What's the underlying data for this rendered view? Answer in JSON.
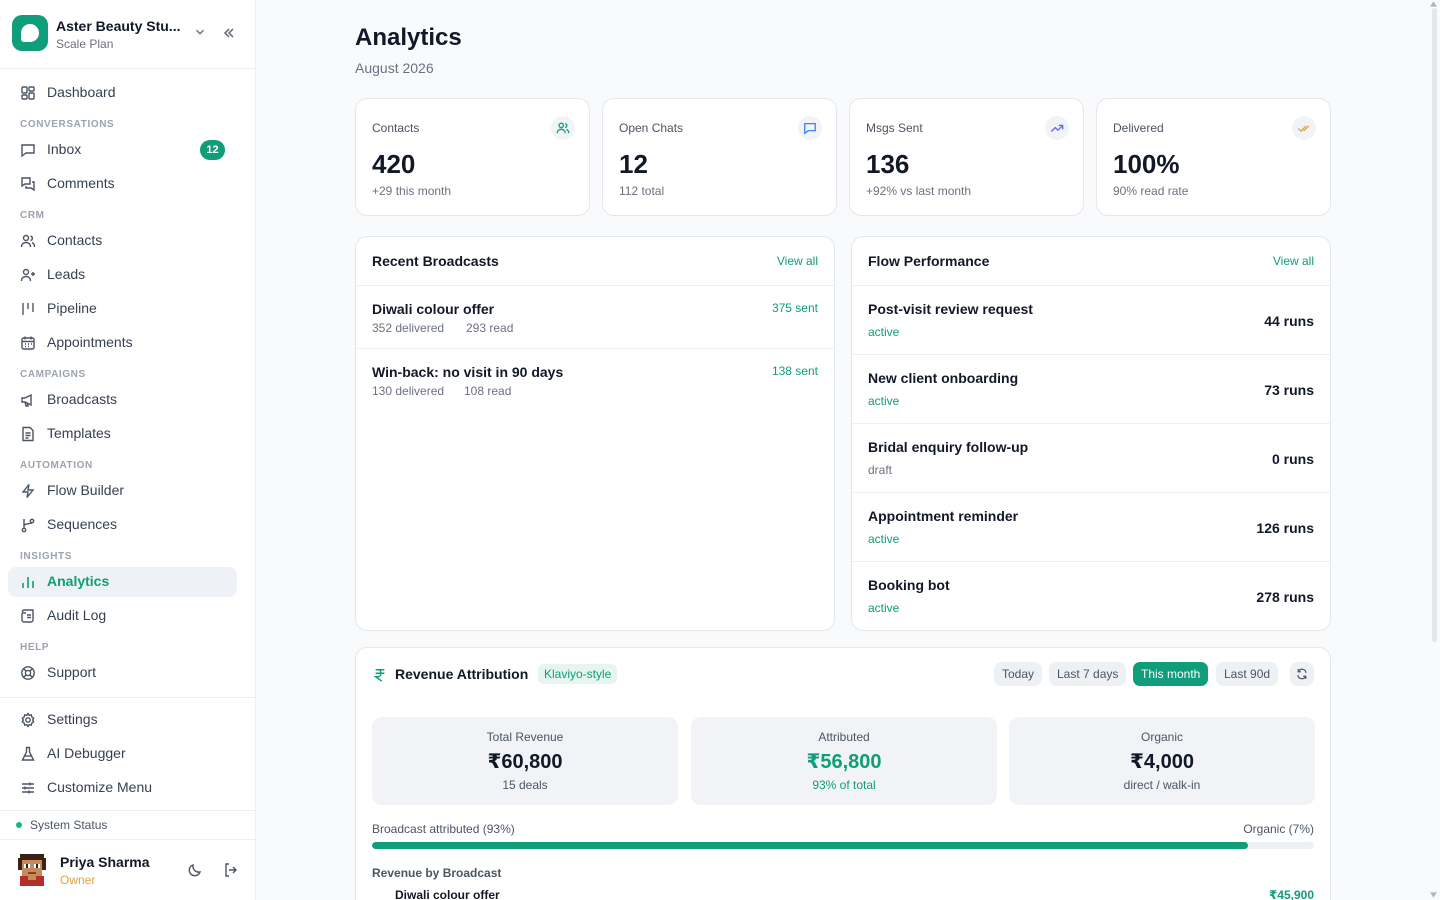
{
  "workspace": {
    "name": "Aster Beauty Stu...",
    "plan": "Scale Plan"
  },
  "nav": {
    "dashboard": "Dashboard",
    "sections": {
      "conversations": "CONVERSATIONS",
      "crm": "CRM",
      "campaigns": "CAMPAIGNS",
      "automation": "AUTOMATION",
      "insights": "INSIGHTS",
      "help": "HELP"
    },
    "inbox": "Inbox",
    "inbox_badge": "12",
    "comments": "Comments",
    "contacts": "Contacts",
    "leads": "Leads",
    "pipeline": "Pipeline",
    "appointments": "Appointments",
    "broadcasts": "Broadcasts",
    "templates": "Templates",
    "flow_builder": "Flow Builder",
    "sequences": "Sequences",
    "analytics": "Analytics",
    "audit_log": "Audit Log",
    "support": "Support",
    "settings": "Settings",
    "ai_debugger": "AI Debugger",
    "customize_menu": "Customize Menu",
    "system_status": "System Status"
  },
  "user": {
    "name": "Priya Sharma",
    "role": "Owner"
  },
  "page": {
    "title": "Analytics",
    "subtitle": "August 2026"
  },
  "stats": [
    {
      "label": "Contacts",
      "value": "420",
      "note": "+29 this month",
      "icon": "users-icon"
    },
    {
      "label": "Open Chats",
      "value": "12",
      "note": "112 total",
      "icon": "chat-icon"
    },
    {
      "label": "Msgs Sent",
      "value": "136",
      "note": "+92% vs last month",
      "icon": "trend-up-icon"
    },
    {
      "label": "Delivered",
      "value": "100%",
      "note": "90% read rate",
      "icon": "double-check-icon"
    }
  ],
  "broadcasts": {
    "title": "Recent Broadcasts",
    "view_all": "View all",
    "items": [
      {
        "name": "Diwali colour offer",
        "delivered": "352 delivered",
        "read": "293 read",
        "sent": "375 sent"
      },
      {
        "name": "Win-back: no visit in 90 days",
        "delivered": "130 delivered",
        "read": "108 read",
        "sent": "138 sent"
      }
    ]
  },
  "flows": {
    "title": "Flow Performance",
    "view_all": "View all",
    "items": [
      {
        "name": "Post-visit review request",
        "status": "active",
        "runs": "44 runs"
      },
      {
        "name": "New client onboarding",
        "status": "active",
        "runs": "73 runs"
      },
      {
        "name": "Bridal enquiry follow-up",
        "status": "draft",
        "runs": "0 runs"
      },
      {
        "name": "Appointment reminder",
        "status": "active",
        "runs": "126 runs"
      },
      {
        "name": "Booking bot",
        "status": "active",
        "runs": "278 runs"
      }
    ]
  },
  "revenue": {
    "title": "Revenue Attribution",
    "tag": "Klaviyo-style",
    "ranges": [
      "Today",
      "Last 7 days",
      "This month",
      "Last 90d"
    ],
    "active_range": "This month",
    "kpis": [
      {
        "label": "Total Revenue",
        "value": "₹60,800",
        "note": "15 deals"
      },
      {
        "label": "Attributed",
        "value": "₹56,800",
        "note": "93% of total"
      },
      {
        "label": "Organic",
        "value": "₹4,000",
        "note": "direct / walk-in"
      }
    ],
    "broadcast_attributed_label": "Broadcast attributed (93%)",
    "organic_label": "Organic (7%)",
    "attributed_fraction": 0.93,
    "by_broadcast_title": "Revenue by Broadcast",
    "by_broadcast": [
      {
        "name": "Diwali colour offer",
        "value": "₹45,900"
      }
    ]
  },
  "colors": {
    "accent": "#0f9d7a",
    "owner": "#e0a33e",
    "status_ok": "#10b981"
  }
}
